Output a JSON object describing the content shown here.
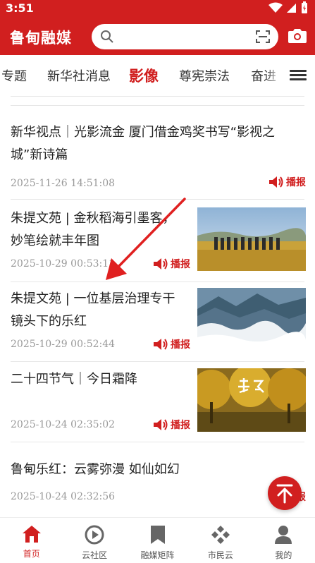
{
  "status_bar": {
    "time": "3:51"
  },
  "header": {
    "app_title": "鲁甸融媒",
    "search_placeholder": ""
  },
  "tabs": [
    {
      "label": "专题",
      "active": false
    },
    {
      "label": "新华社消息",
      "active": false
    },
    {
      "label": "影像",
      "active": true
    },
    {
      "label": "尊宪崇法",
      "active": false
    },
    {
      "label": "奋进",
      "active": false
    }
  ],
  "articles": [
    {
      "title": "新华视点｜光影流金 厦门借金鸡奖书写“影视之城”新诗篇",
      "datetime": "2025-11-26 14:51:08",
      "play_label": "播报",
      "thumb": "none"
    },
    {
      "title": "朱提文苑 | 金秋稻海引墨客，妙笔绘就丰年图",
      "datetime": "2025-10-29 00:53:11",
      "play_label": "播报",
      "thumb": "rice-field-group-photo"
    },
    {
      "title": "朱提文苑 | 一位基层治理专干镜头下的乐红",
      "datetime": "2025-10-29 00:52:44",
      "play_label": "播报",
      "thumb": "mountain-clouds"
    },
    {
      "title": "二十四节气｜今日霜降",
      "datetime": "2025-10-24 02:35:02",
      "play_label": "播报",
      "thumb": "golden-trees-frost-descent"
    },
    {
      "title": "鲁甸乐红：云雾弥漫 如仙如幻",
      "datetime": "2025-10-24 02:32:56",
      "play_label": "播报",
      "thumb": "none"
    }
  ],
  "bottom_nav": [
    {
      "label": "首页",
      "icon": "home-icon",
      "active": true
    },
    {
      "label": "云社区",
      "icon": "play-circle-icon",
      "active": false
    },
    {
      "label": "融媒矩阵",
      "icon": "bookmark-icon",
      "active": false
    },
    {
      "label": "市民云",
      "icon": "diamond-grid-icon",
      "active": false
    },
    {
      "label": "我的",
      "icon": "person-icon",
      "active": false
    }
  ],
  "colors": {
    "brand_red": "#d11f1f",
    "text": "#222222",
    "meta_gray": "#999999"
  }
}
